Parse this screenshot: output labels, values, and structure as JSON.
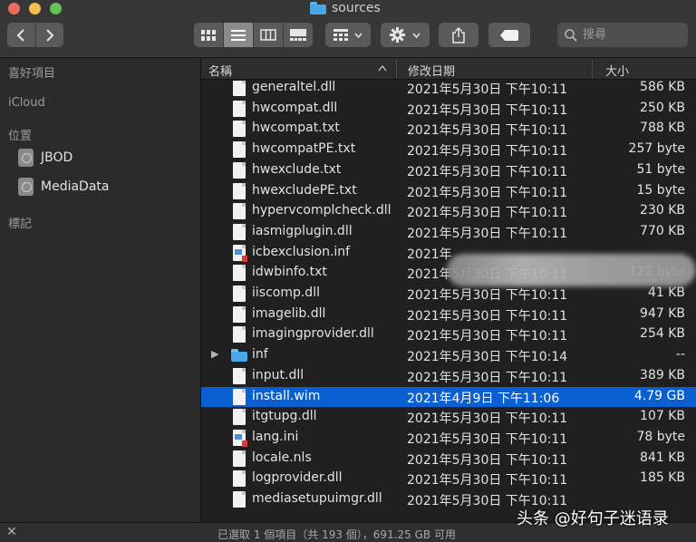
{
  "window": {
    "title": "sources"
  },
  "toolbar": {
    "view_modes": [
      "icon-view",
      "list-view",
      "column-view",
      "gallery-view"
    ],
    "group_icon": "group-icon",
    "action_icon": "gear-icon",
    "share_icon": "share-icon",
    "tag_icon": "tag-icon",
    "search_placeholder": "搜尋"
  },
  "sidebar": {
    "favorites_header": "喜好項目",
    "icloud_header": "iCloud",
    "locations_header": "位置",
    "locations": [
      {
        "label": "JBOD",
        "icon": "disk-icon"
      },
      {
        "label": "MediaData",
        "icon": "disk-icon"
      }
    ],
    "tags_header": "標記"
  },
  "columns": {
    "name": "名稱",
    "date": "修改日期",
    "size": "大小"
  },
  "files": [
    {
      "name": "generaltel.dll",
      "date": "2021年5月30日 下午10:11",
      "size": "586 KB",
      "kind": "file"
    },
    {
      "name": "hwcompat.dll",
      "date": "2021年5月30日 下午10:11",
      "size": "250 KB",
      "kind": "file"
    },
    {
      "name": "hwcompat.txt",
      "date": "2021年5月30日 下午10:11",
      "size": "788 KB",
      "kind": "file"
    },
    {
      "name": "hwcompatPE.txt",
      "date": "2021年5月30日 下午10:11",
      "size": "257 byte",
      "kind": "file"
    },
    {
      "name": "hwexclude.txt",
      "date": "2021年5月30日 下午10:11",
      "size": "51 byte",
      "kind": "file"
    },
    {
      "name": "hwexcludePE.txt",
      "date": "2021年5月30日 下午10:11",
      "size": "15 byte",
      "kind": "file"
    },
    {
      "name": "hypervcomplcheck.dll",
      "date": "2021年5月30日 下午10:11",
      "size": "230 KB",
      "kind": "file"
    },
    {
      "name": "iasmigplugin.dll",
      "date": "2021年5月30日 下午10:11",
      "size": "770 KB",
      "kind": "file"
    },
    {
      "name": "icbexclusion.inf",
      "date": "2021年",
      "size": "",
      "kind": "cfg"
    },
    {
      "name": "idwbinfo.txt",
      "date": "2021年5月30日 下午10:11",
      "size": "122 byte",
      "kind": "file"
    },
    {
      "name": "iiscomp.dll",
      "date": "2021年5月30日 下午10:11",
      "size": "41 KB",
      "kind": "file"
    },
    {
      "name": "imagelib.dll",
      "date": "2021年5月30日 下午10:11",
      "size": "947 KB",
      "kind": "file"
    },
    {
      "name": "imagingprovider.dll",
      "date": "2021年5月30日 下午10:11",
      "size": "254 KB",
      "kind": "file"
    },
    {
      "name": "inf",
      "date": "2021年5月30日 下午10:14",
      "size": "--",
      "kind": "folder"
    },
    {
      "name": "input.dll",
      "date": "2021年5月30日 下午10:11",
      "size": "389 KB",
      "kind": "file"
    },
    {
      "name": "install.wim",
      "date": "2021年4月9日 下午11:06",
      "size": "4.79 GB",
      "kind": "file",
      "selected": true
    },
    {
      "name": "itgtupg.dll",
      "date": "2021年5月30日 下午10:11",
      "size": "107 KB",
      "kind": "file"
    },
    {
      "name": "lang.ini",
      "date": "2021年5月30日 下午10:11",
      "size": "78 byte",
      "kind": "cfg"
    },
    {
      "name": "locale.nls",
      "date": "2021年5月30日 下午10:11",
      "size": "841 KB",
      "kind": "file"
    },
    {
      "name": "logprovider.dll",
      "date": "2021年5月30日 下午10:11",
      "size": "185 KB",
      "kind": "file"
    },
    {
      "name": "mediasetupuimgr.dll",
      "date": "2021年5月30日 下午10:11",
      "size": "",
      "kind": "file"
    }
  ],
  "status": {
    "text": "已選取 1 個項目（共 193 個），691.25 GB 可用"
  },
  "watermark": "头条 @好句子迷语录",
  "colors": {
    "selection": "#0a5fd1",
    "folder": "#4aa8ea",
    "background": "#202020"
  }
}
